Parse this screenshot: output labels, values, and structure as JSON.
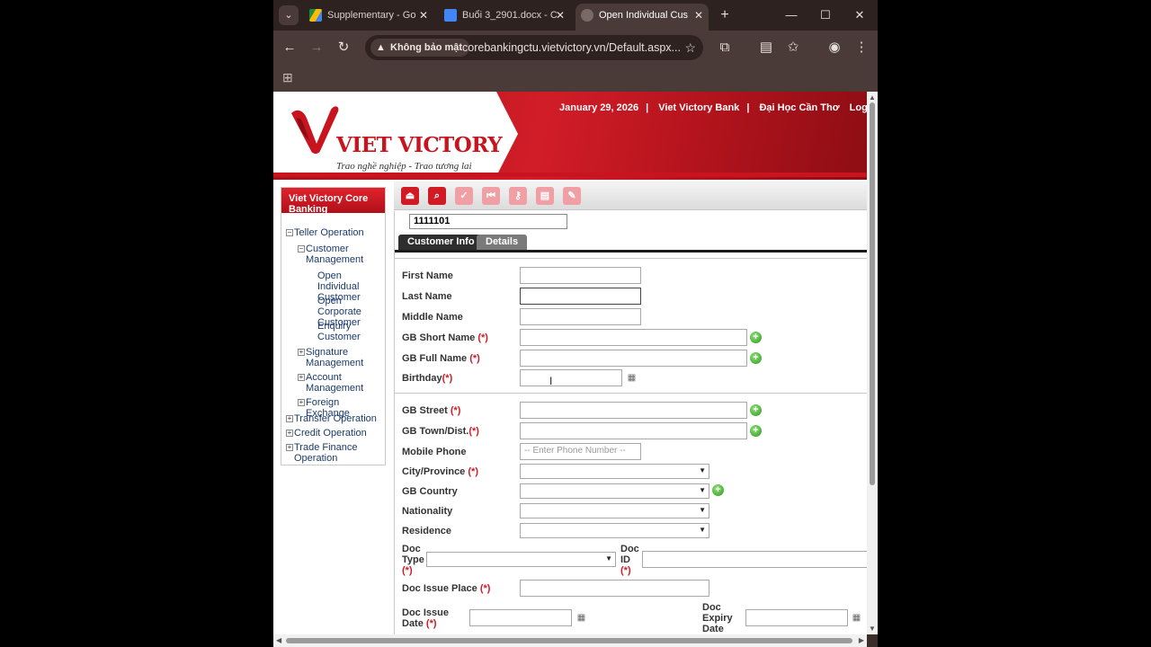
{
  "browser": {
    "tabs": [
      {
        "title": "Supplementary - Go",
        "icon": "google-drive-icon"
      },
      {
        "title": "Buổi 3_2901.docx - C",
        "icon": "google-docs-icon"
      },
      {
        "title": "Open Individual Cus",
        "icon": "app-icon"
      }
    ],
    "security_label": "Không bảo mật",
    "url": "corebankingctu.vietvictory.vn/Default.aspx..."
  },
  "banner": {
    "logo_text": "VIET VICTORY",
    "slogan": "Trao nghề nghiệp - Trao tương lai",
    "date": "January 29, 2026",
    "bank": "Viet Victory Bank",
    "branch": "Đại Học Cần Thơ",
    "logout": "Logout"
  },
  "sidebar": {
    "header": "Viet Victory Core Banking",
    "tree": {
      "teller": "Teller Operation",
      "customer_mgmt": "Customer Management",
      "open_individual": "Open Individual Customer",
      "open_corporate": "Open Corporate Customer",
      "enquiry": "Enquiry Customer",
      "signature": "Signature Management",
      "account": "Account Management",
      "forex": "Foreign Exchange",
      "transfer": "Transfer Operation",
      "credit": "Credit Operation",
      "trade": "Trade Finance Operation"
    }
  },
  "form": {
    "customer_id": "1111101",
    "tab_info": "Customer Info",
    "tab_details": "Details",
    "first_name": "First Name",
    "last_name": "Last Name",
    "middle_name": "Middle Name",
    "gb_short_name": "GB Short Name",
    "gb_full_name": "GB Full Name",
    "birthday": "Birthday",
    "gb_street": "GB Street",
    "gb_town": "GB Town/Dist.",
    "mobile_phone": "Mobile Phone",
    "mobile_placeholder": "-- Enter Phone Number --",
    "city": "City/Province",
    "gb_country": "GB Country",
    "nationality": "Nationality",
    "residence": "Residence",
    "doc_type": "Doc Type",
    "doc_id": "Doc ID",
    "doc_issue_place": "Doc Issue Place",
    "doc_issue_date": "Doc Issue Date",
    "doc_expiry_date": "Doc Expiry Date",
    "required_mark": "(*)"
  },
  "colors": {
    "brand_red": "#c9141f",
    "tab_active": "#2e2e2e"
  }
}
